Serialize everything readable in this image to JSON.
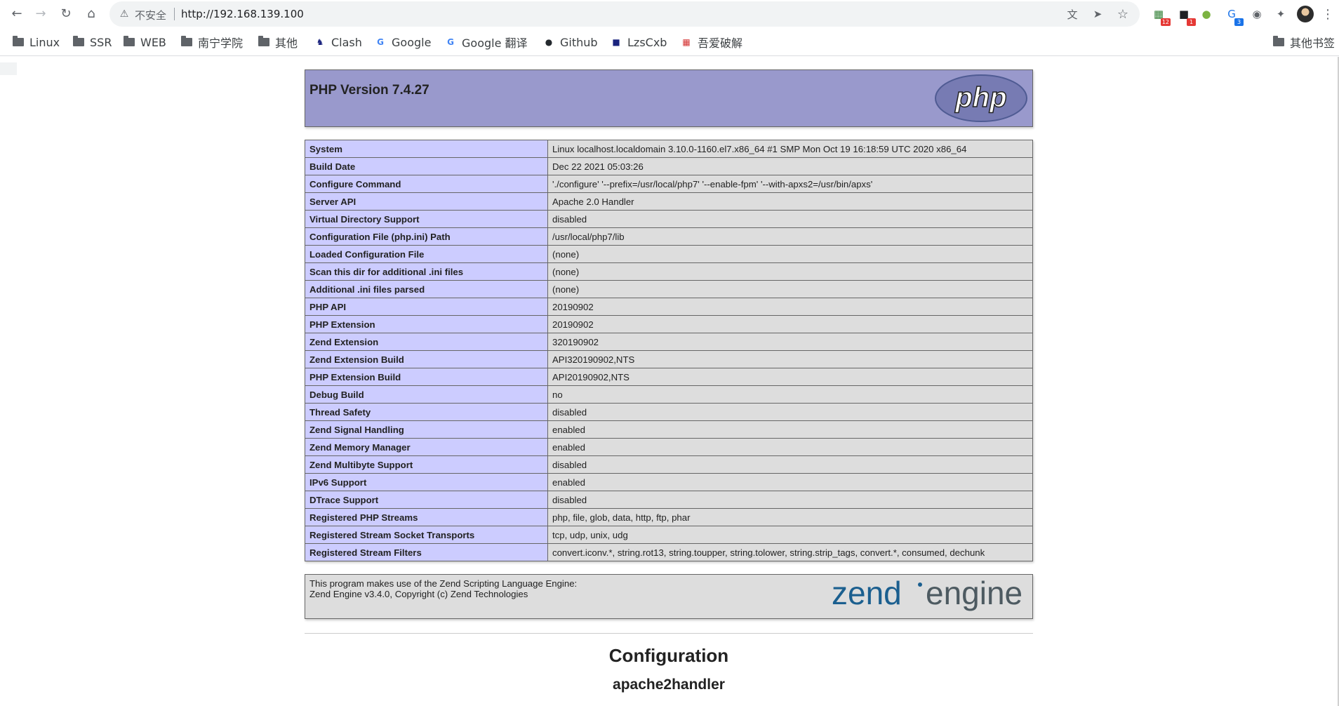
{
  "browser": {
    "nav": {
      "back_icon": "←",
      "forward_icon": "→",
      "reload_icon": "↻",
      "home_icon": "⌂"
    },
    "omnibox": {
      "warning_icon": "⚠",
      "security_label": "不安全",
      "url": "http://192.168.139.100",
      "translate_icon": "文",
      "send_icon": "➤",
      "star_icon": "☆"
    },
    "extensions": [
      {
        "name": "ext-grid",
        "glyph": "▦",
        "badge": "12",
        "badge_color": "#e53935",
        "color": "#2e7d32"
      },
      {
        "name": "ext-dark",
        "glyph": "■",
        "badge": "1",
        "badge_color": "#e53935",
        "color": "#202124"
      },
      {
        "name": "ext-circle",
        "glyph": "●",
        "badge": "",
        "badge_color": "",
        "color": "#7cb342"
      },
      {
        "name": "ext-g",
        "glyph": "G",
        "badge": "3",
        "badge_color": "#1a73e8",
        "color": "#1a73e8"
      },
      {
        "name": "ext-shield",
        "glyph": "◉",
        "badge": "",
        "badge_color": "",
        "color": "#5f6368"
      },
      {
        "name": "ext-puzzle",
        "glyph": "✦",
        "badge": "",
        "badge_color": "",
        "color": "#5f6368"
      }
    ],
    "menu_icon": "⋮",
    "bookmarks": [
      {
        "label": "Linux",
        "type": "folder"
      },
      {
        "label": "SSR",
        "type": "folder"
      },
      {
        "label": "WEB",
        "type": "folder"
      },
      {
        "label": "南宁学院",
        "type": "folder"
      },
      {
        "label": "其他",
        "type": "folder"
      },
      {
        "label": "Clash",
        "type": "site",
        "glyph": "♞",
        "color": "#1a237e"
      },
      {
        "label": "Google",
        "type": "site",
        "glyph": "G",
        "color": "#4285f4"
      },
      {
        "label": "Google 翻译",
        "type": "site",
        "glyph": "G",
        "color": "#4285f4"
      },
      {
        "label": "Github",
        "type": "site",
        "glyph": "●",
        "color": "#24292e"
      },
      {
        "label": "LzsCxb",
        "type": "site",
        "glyph": "■",
        "color": "#1a237e"
      },
      {
        "label": "吾爱破解",
        "type": "site",
        "glyph": "▦",
        "color": "#d32f2f"
      }
    ],
    "other_bookmarks": "其他书签"
  },
  "phpinfo": {
    "title": "PHP Version 7.4.27",
    "php_logo_text": "php",
    "rows": [
      {
        "key": "System",
        "value": "Linux localhost.localdomain 3.10.0-1160.el7.x86_64 #1 SMP Mon Oct 19 16:18:59 UTC 2020 x86_64"
      },
      {
        "key": "Build Date",
        "value": "Dec 22 2021 05:03:26"
      },
      {
        "key": "Configure Command",
        "value": "'./configure' '--prefix=/usr/local/php7' '--enable-fpm' '--with-apxs2=/usr/bin/apxs'"
      },
      {
        "key": "Server API",
        "value": "Apache 2.0 Handler"
      },
      {
        "key": "Virtual Directory Support",
        "value": "disabled"
      },
      {
        "key": "Configuration File (php.ini) Path",
        "value": "/usr/local/php7/lib"
      },
      {
        "key": "Loaded Configuration File",
        "value": "(none)"
      },
      {
        "key": "Scan this dir for additional .ini files",
        "value": "(none)"
      },
      {
        "key": "Additional .ini files parsed",
        "value": "(none)"
      },
      {
        "key": "PHP API",
        "value": "20190902"
      },
      {
        "key": "PHP Extension",
        "value": "20190902"
      },
      {
        "key": "Zend Extension",
        "value": "320190902"
      },
      {
        "key": "Zend Extension Build",
        "value": "API320190902,NTS"
      },
      {
        "key": "PHP Extension Build",
        "value": "API20190902,NTS"
      },
      {
        "key": "Debug Build",
        "value": "no"
      },
      {
        "key": "Thread Safety",
        "value": "disabled"
      },
      {
        "key": "Zend Signal Handling",
        "value": "enabled"
      },
      {
        "key": "Zend Memory Manager",
        "value": "enabled"
      },
      {
        "key": "Zend Multibyte Support",
        "value": "disabled"
      },
      {
        "key": "IPv6 Support",
        "value": "enabled"
      },
      {
        "key": "DTrace Support",
        "value": "disabled"
      },
      {
        "key": "Registered PHP Streams",
        "value": "php, file, glob, data, http, ftp, phar"
      },
      {
        "key": "Registered Stream Socket Transports",
        "value": "tcp, udp, unix, udg"
      },
      {
        "key": "Registered Stream Filters",
        "value": "convert.iconv.*, string.rot13, string.toupper, string.tolower, string.strip_tags, convert.*, consumed, dechunk"
      }
    ],
    "zend": {
      "line1": "This program makes use of the Zend Scripting Language Engine:",
      "line2": "Zend Engine v3.4.0, Copyright (c) Zend Technologies",
      "logo_word1": "zend",
      "logo_word2": "engine"
    },
    "configuration_heading": "Configuration",
    "module_heading": "apache2handler"
  },
  "colors": {
    "header_bg": "#9999cc",
    "key_bg": "#ccccff",
    "value_bg": "#dddddd",
    "border": "#666666",
    "php_logo": "#777bb3",
    "zend_blue": "#1b5f8f",
    "zend_gray": "#4d5a61"
  }
}
